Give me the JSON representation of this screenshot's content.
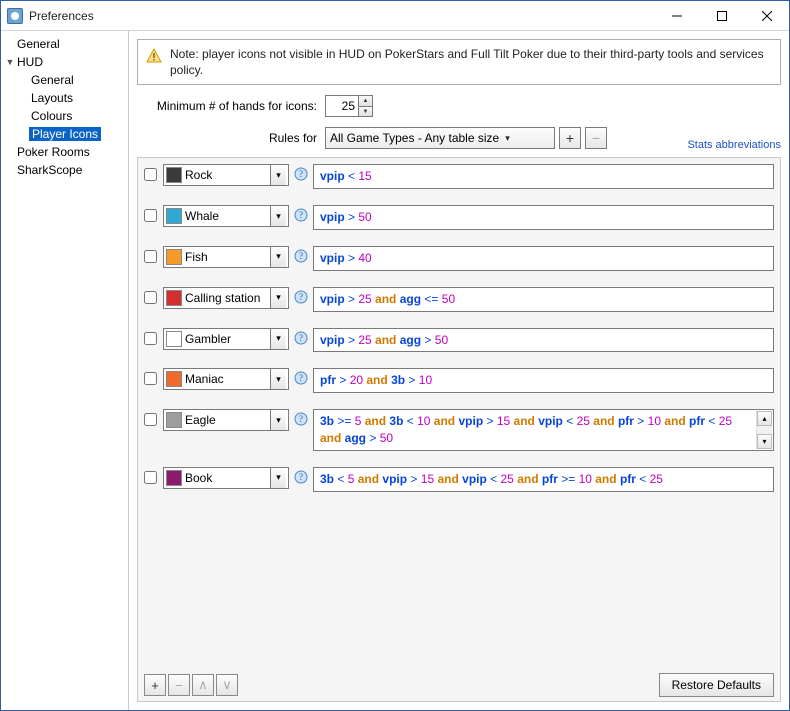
{
  "window": {
    "title": "Preferences"
  },
  "sidebar": {
    "items": [
      {
        "label": "General",
        "depth": 0,
        "expandable": false
      },
      {
        "label": "HUD",
        "depth": 0,
        "expandable": true,
        "expanded": true
      },
      {
        "label": "General",
        "depth": 1
      },
      {
        "label": "Layouts",
        "depth": 1
      },
      {
        "label": "Colours",
        "depth": 1
      },
      {
        "label": "Player Icons",
        "depth": 1,
        "selected": true
      },
      {
        "label": "Poker Rooms",
        "depth": 0
      },
      {
        "label": "SharkScope",
        "depth": 0
      }
    ]
  },
  "note": "Note: player icons not visible in HUD on PokerStars and Full Tilt Poker due to their third-party tools and services policy.",
  "form": {
    "min_hands_label": "Minimum # of hands for icons:",
    "min_hands_value": "25",
    "rules_for_label": "Rules for",
    "rules_for_value": "All Game Types - Any table size"
  },
  "stats_link": "Stats abbreviations",
  "rules": [
    {
      "name": "Rock",
      "icon_bg": "#3a3a3a",
      "expr": [
        [
          "stat",
          "vpip"
        ],
        [
          "op",
          " < "
        ],
        [
          "num",
          "15"
        ]
      ]
    },
    {
      "name": "Whale",
      "icon_bg": "#2ea9d6",
      "expr": [
        [
          "stat",
          "vpip"
        ],
        [
          "op",
          " > "
        ],
        [
          "num",
          "50"
        ]
      ]
    },
    {
      "name": "Fish",
      "icon_bg": "#f89a2a",
      "expr": [
        [
          "stat",
          "vpip"
        ],
        [
          "op",
          " > "
        ],
        [
          "num",
          "40"
        ]
      ]
    },
    {
      "name": "Calling station",
      "icon_bg": "#d42f2f",
      "expr": [
        [
          "stat",
          "vpip"
        ],
        [
          "op",
          " > "
        ],
        [
          "num",
          "25"
        ],
        [
          "and",
          " and "
        ],
        [
          "stat",
          "agg"
        ],
        [
          "op",
          " <= "
        ],
        [
          "num",
          "50"
        ]
      ]
    },
    {
      "name": "Gambler",
      "icon_bg": "#ffffff",
      "expr": [
        [
          "stat",
          "vpip"
        ],
        [
          "op",
          " > "
        ],
        [
          "num",
          "25"
        ],
        [
          "and",
          " and "
        ],
        [
          "stat",
          "agg"
        ],
        [
          "op",
          " > "
        ],
        [
          "num",
          "50"
        ]
      ]
    },
    {
      "name": "Maniac",
      "icon_bg": "#f06a2a",
      "expr": [
        [
          "stat",
          "pfr"
        ],
        [
          "op",
          " > "
        ],
        [
          "num",
          "20"
        ],
        [
          "and",
          " and "
        ],
        [
          "stat",
          "3b"
        ],
        [
          "op",
          " > "
        ],
        [
          "num",
          "10"
        ]
      ]
    },
    {
      "name": "Eagle",
      "icon_bg": "#9e9e9e",
      "scroll": true,
      "expr": [
        [
          "stat",
          "3b"
        ],
        [
          "op",
          " >= "
        ],
        [
          "num",
          "5"
        ],
        [
          "and",
          " and "
        ],
        [
          "stat",
          "3b"
        ],
        [
          "op",
          " < "
        ],
        [
          "num",
          "10"
        ],
        [
          "and",
          " and  "
        ],
        [
          "stat",
          "vpip"
        ],
        [
          "op",
          " > "
        ],
        [
          "num",
          "15"
        ],
        [
          "and",
          " and "
        ],
        [
          "stat",
          "vpip"
        ],
        [
          "op",
          " < "
        ],
        [
          "num",
          "25"
        ],
        [
          "and",
          " and "
        ],
        [
          "stat",
          "pfr"
        ],
        [
          "op",
          " > "
        ],
        [
          "num",
          "10"
        ],
        [
          "and",
          " and "
        ],
        [
          "stat",
          "pfr"
        ],
        [
          "op",
          " < "
        ],
        [
          "num",
          "25"
        ],
        [
          "and",
          " and "
        ],
        [
          "stat",
          "agg"
        ],
        [
          "op",
          " > "
        ],
        [
          "num",
          "50"
        ]
      ]
    },
    {
      "name": "Book",
      "icon_bg": "#8e1a6e",
      "expr": [
        [
          "stat",
          "3b"
        ],
        [
          "op",
          " < "
        ],
        [
          "num",
          "5"
        ],
        [
          "and",
          " and "
        ],
        [
          "stat",
          "vpip"
        ],
        [
          "op",
          " > "
        ],
        [
          "num",
          "15"
        ],
        [
          "and",
          " and "
        ],
        [
          "stat",
          "vpip"
        ],
        [
          "op",
          " < "
        ],
        [
          "num",
          "25"
        ],
        [
          "and",
          " and "
        ],
        [
          "stat",
          "pfr"
        ],
        [
          "op",
          " >= "
        ],
        [
          "num",
          "10"
        ],
        [
          "and",
          " and "
        ],
        [
          "stat",
          "pfr"
        ],
        [
          "op",
          " < "
        ],
        [
          "num",
          "25"
        ]
      ]
    }
  ],
  "buttons": {
    "add": "+",
    "remove": "−",
    "up": "∧",
    "down": "∨",
    "restore": "Restore Defaults"
  }
}
